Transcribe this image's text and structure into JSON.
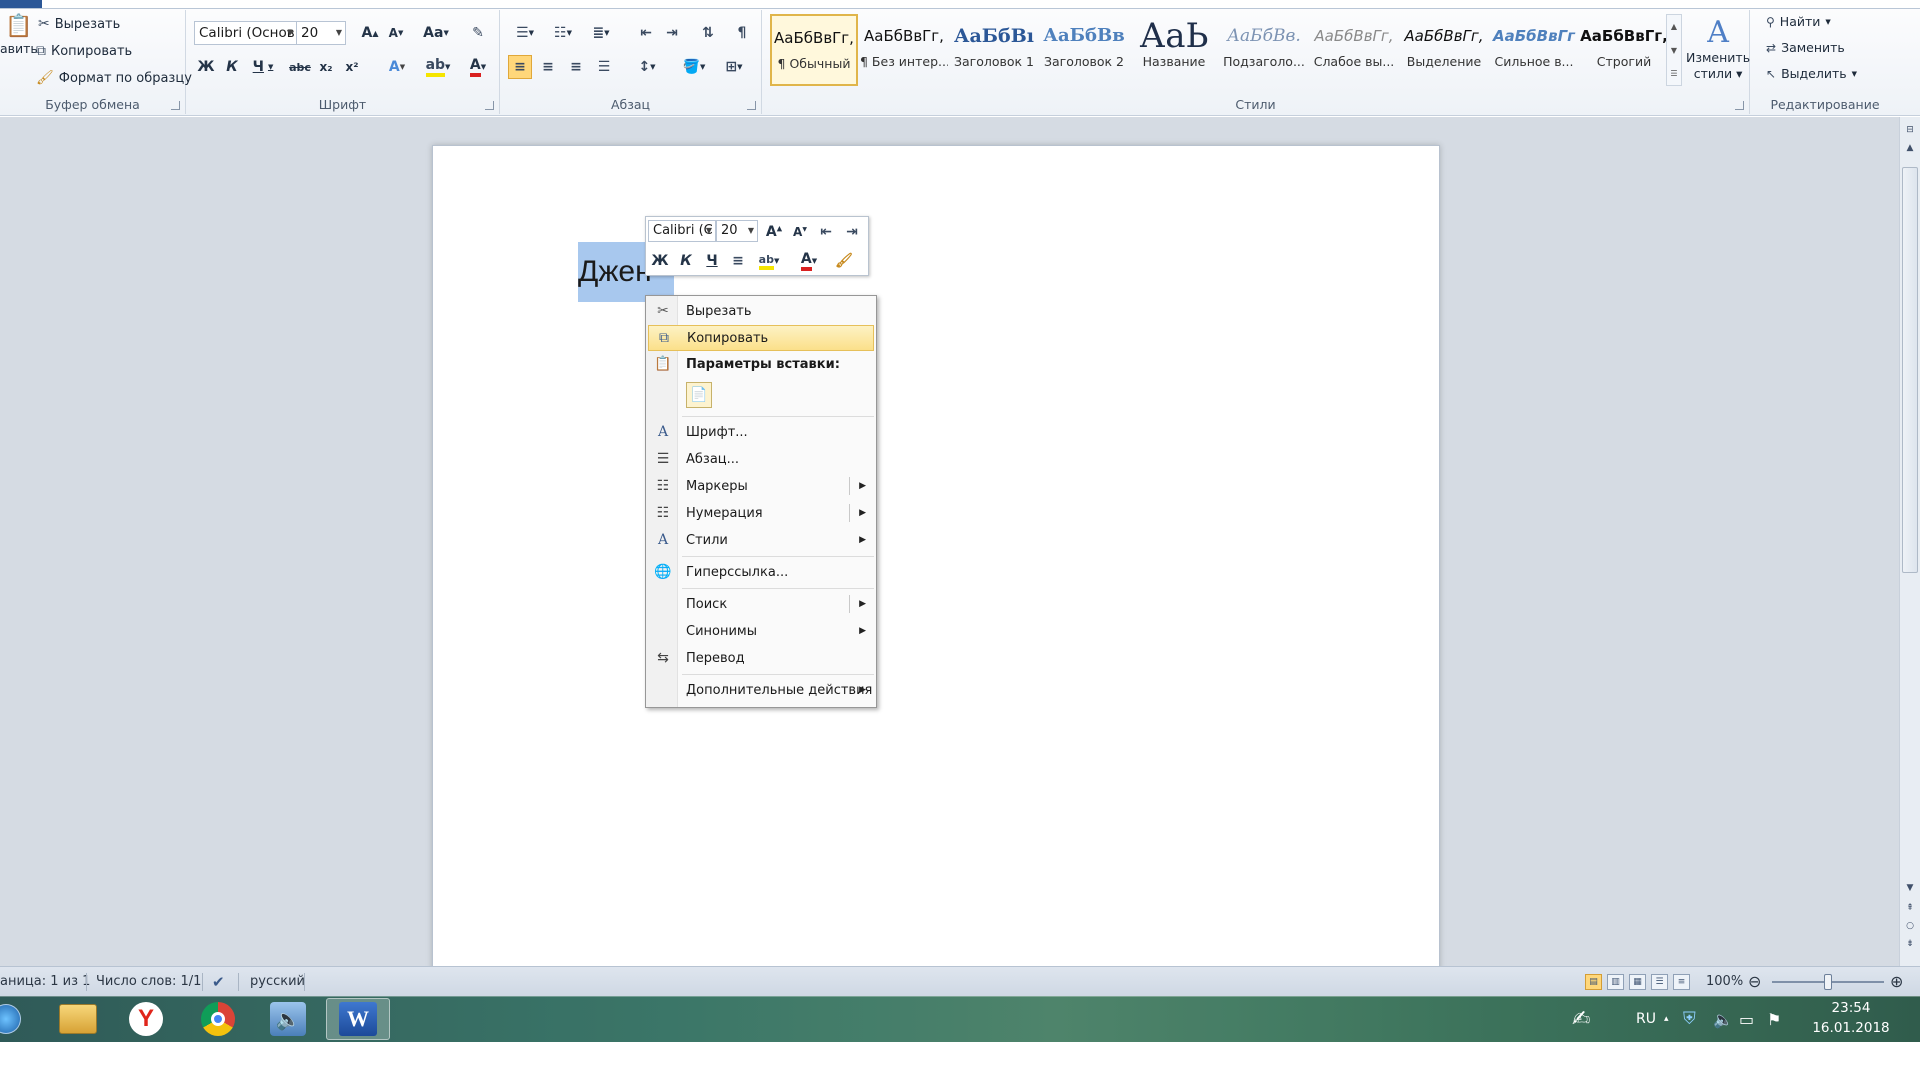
{
  "clipboard": {
    "paste_label": "авить",
    "cut_label": "Вырезать",
    "copy_label": "Копировать",
    "format_painter_label": "Формат по образцу",
    "group_label": "Буфер обмена"
  },
  "font": {
    "family": "Calibri (Основ",
    "size": "20",
    "group_label": "Шрифт",
    "bold": "Ж",
    "italic": "К",
    "underline": "Ч",
    "strikethrough": "abc",
    "subscript": "x₂",
    "superscript": "x²",
    "grow": "A",
    "shrink": "A",
    "case": "Aa"
  },
  "paragraph": {
    "group_label": "Абзац"
  },
  "styles": {
    "group_label": "Стили",
    "items": [
      {
        "sample": "АаБбВвГг,",
        "name": "¶ Обычный"
      },
      {
        "sample": "АаБбВвГг,",
        "name": "¶ Без интер..."
      },
      {
        "sample": "АаБбВı",
        "name": "Заголовок 1"
      },
      {
        "sample": "АаБбВв",
        "name": "Заголовок 2"
      },
      {
        "sample": "АаЬ",
        "name": "Название"
      },
      {
        "sample": "АаБбВв.",
        "name": "Подзаголо..."
      },
      {
        "sample": "АаБбВвГг,",
        "name": "Слабое вы..."
      },
      {
        "sample": "АаБбВвГг,",
        "name": "Выделение"
      },
      {
        "sample": "АаБбВвГг",
        "name": "Сильное в..."
      },
      {
        "sample": "АаБбВвГг,",
        "name": "Строгий"
      }
    ],
    "change_styles_label_1": "Изменить",
    "change_styles_label_2": "стили"
  },
  "editing": {
    "group_label": "Редактирование",
    "find_label": "Найти",
    "replace_label": "Заменить",
    "select_label": "Выделить"
  },
  "document": {
    "selected_text": "Джен"
  },
  "mini_toolbar": {
    "font_family": "Calibri (С",
    "font_size": "20",
    "bold": "Ж",
    "italic": "К",
    "underline": "Ч"
  },
  "context_menu": {
    "cut": "Вырезать",
    "copy": "Копировать",
    "paste_options": "Параметры вставки:",
    "font": "Шрифт...",
    "paragraph": "Абзац...",
    "bullets": "Маркеры",
    "numbering": "Нумерация",
    "styles": "Стили",
    "hyperlink": "Гиперссылка...",
    "search": "Поиск",
    "synonyms": "Синонимы",
    "translate": "Перевод",
    "additional_actions": "Дополнительные действия"
  },
  "statusbar": {
    "page": "аница: 1 из 1",
    "words": "Число слов: 1/1",
    "language": "русский",
    "zoom": "100%",
    "zoom_level_percent": 100
  },
  "taskbar": {
    "language": "RU",
    "time": "23:54",
    "date": "16.01.2018"
  },
  "colors": {
    "accent_blue": "#2b5797",
    "selection": "#a8c8ee",
    "highlight": "#fbe08a",
    "font_color_red": "#d92020",
    "highlighter_yellow": "#f5e500"
  }
}
